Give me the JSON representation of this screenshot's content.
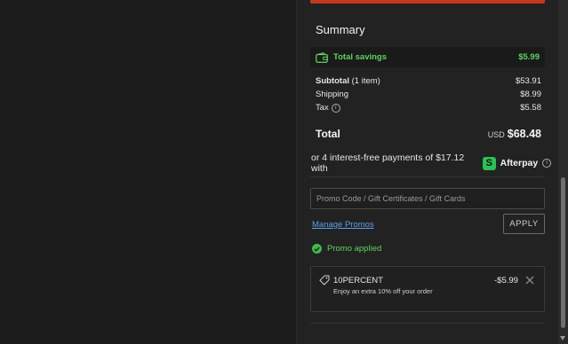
{
  "summary": {
    "title": "Summary",
    "savings": {
      "label": "Total savings",
      "value": "$5.99"
    },
    "subtotal": {
      "label": "Subtotal",
      "qty": "(1 item)",
      "value": "$53.91"
    },
    "shipping": {
      "label": "Shipping",
      "value": "$8.99"
    },
    "tax": {
      "label": "Tax",
      "value": "$5.58"
    },
    "total": {
      "label": "Total",
      "currency": "USD",
      "value": "$68.48"
    }
  },
  "afterpay": {
    "text": "or 4 interest-free payments of $17.12 with",
    "badge": "S",
    "brand": "Afterpay"
  },
  "promo": {
    "placeholder": "Promo Code / Gift Certificates / Gift Cards",
    "manage_label": "Manage Promos",
    "apply_label": "APPLY",
    "applied_label": "Promo applied",
    "code": "10PERCENT",
    "description": "Enjoy an extra 10% off your order",
    "amount": "-$5.99"
  },
  "colors": {
    "accent_green": "#5fd35f",
    "checkout_red": "#c4391b",
    "link_blue": "#5aa0e8"
  }
}
